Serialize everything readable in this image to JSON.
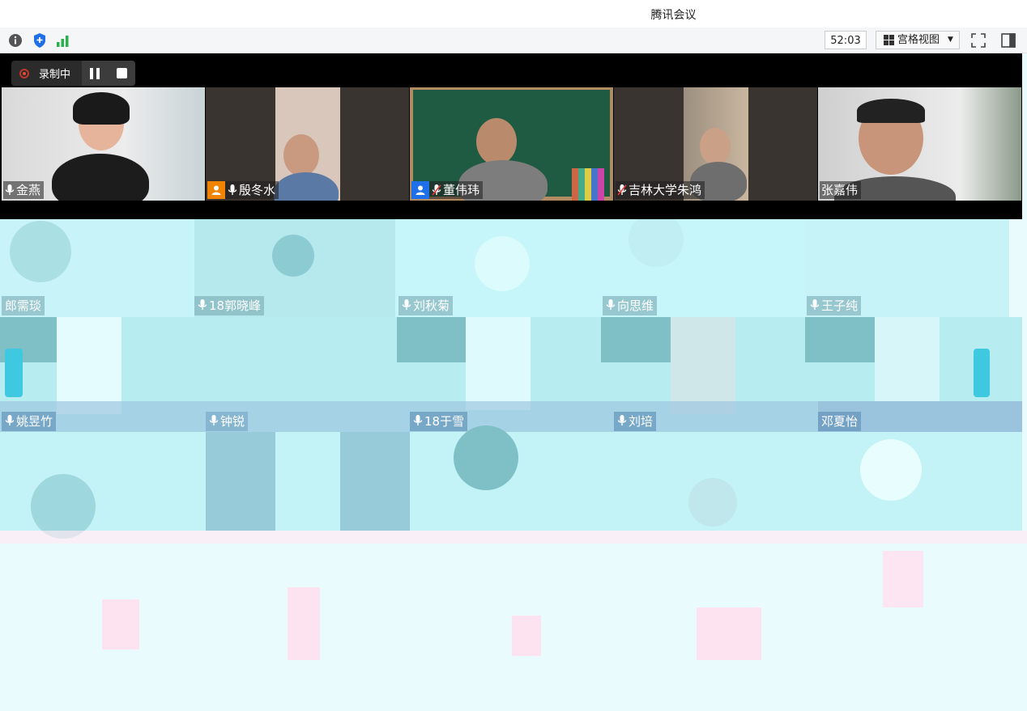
{
  "window": {
    "title": "腾讯会议"
  },
  "toolbar": {
    "timer": "52:03",
    "view_label": "宫格视图",
    "icons": [
      "info-icon",
      "shield-icon",
      "signal-icon",
      "fullscreen-icon",
      "sidebar-icon"
    ]
  },
  "recording": {
    "label": "录制中"
  },
  "participants": {
    "row1": [
      {
        "name": "金燕"
      },
      {
        "name": "殷冬水"
      },
      {
        "name": "董伟玮"
      },
      {
        "name": "吉林大学朱鸿"
      },
      {
        "name": "张嘉伟"
      }
    ],
    "row2": [
      {
        "name": "郎需琰"
      },
      {
        "name": "18郭晓峰"
      },
      {
        "name": "刘秋菊"
      },
      {
        "name": "向思维"
      },
      {
        "name": "王子纯"
      }
    ],
    "row3": [
      {
        "name": "姚昱竹"
      },
      {
        "name": "钟锐"
      },
      {
        "name": "18于雪"
      },
      {
        "name": "刘培"
      },
      {
        "name": "邓夏怡"
      }
    ]
  },
  "colors": {
    "accent_orange": "#f08300",
    "accent_blue": "#1e6fe8",
    "rec_red": "#e74c3c",
    "glitch_cyan": "#c4f7fb"
  }
}
